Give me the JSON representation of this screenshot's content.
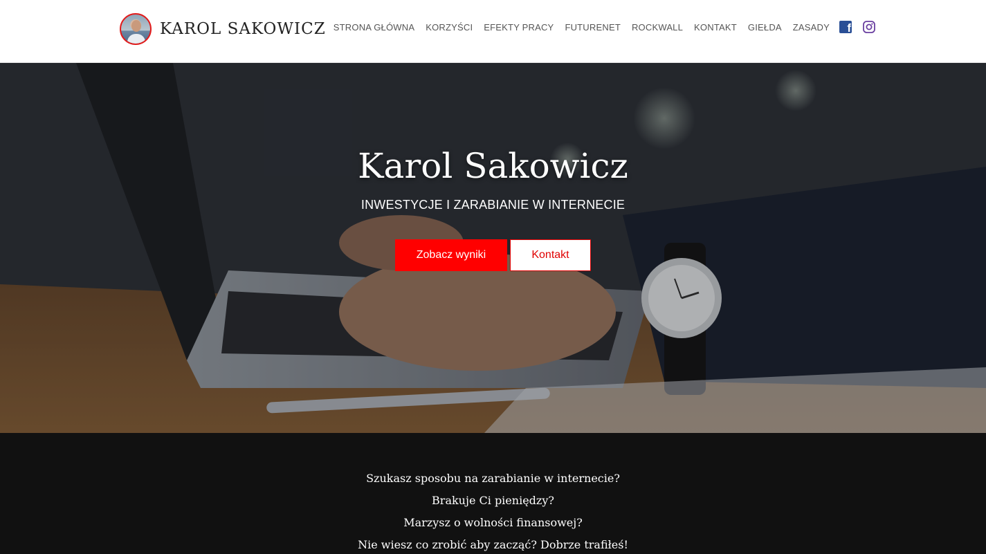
{
  "header": {
    "brand_name": "KAROL SAKOWICZ",
    "nav": [
      {
        "label": "STRONA GŁÓWNA"
      },
      {
        "label": "KORZYŚCI"
      },
      {
        "label": "EFEKTY PRACY"
      },
      {
        "label": "FUTURENET"
      },
      {
        "label": "ROCKWALL"
      },
      {
        "label": "KONTAKT"
      },
      {
        "label": "GIEŁDA"
      },
      {
        "label": "ZASADY"
      }
    ],
    "social_icons": [
      "facebook-icon",
      "instagram-icon"
    ],
    "colors": {
      "facebook": "#2a4f96",
      "instagram": "#6a3fa0",
      "avatar_border": "#e21b1b"
    }
  },
  "hero": {
    "title": "Karol Sakowicz",
    "subtitle": "INWESTYCJE I ZARABIANIE W INTERNECIE",
    "primary_button": "Zobacz wyniki",
    "secondary_button": "Kontakt",
    "colors": {
      "accent": "#ff0000"
    }
  },
  "intro": {
    "lines": [
      "Szukasz sposobu na zarabianie w internecie?",
      "Brakuje Ci pieniędzy?",
      "Marzysz o wolności finansowej?",
      "Nie wiesz co zrobić aby zacząć? Dobrze trafiłeś!"
    ]
  }
}
